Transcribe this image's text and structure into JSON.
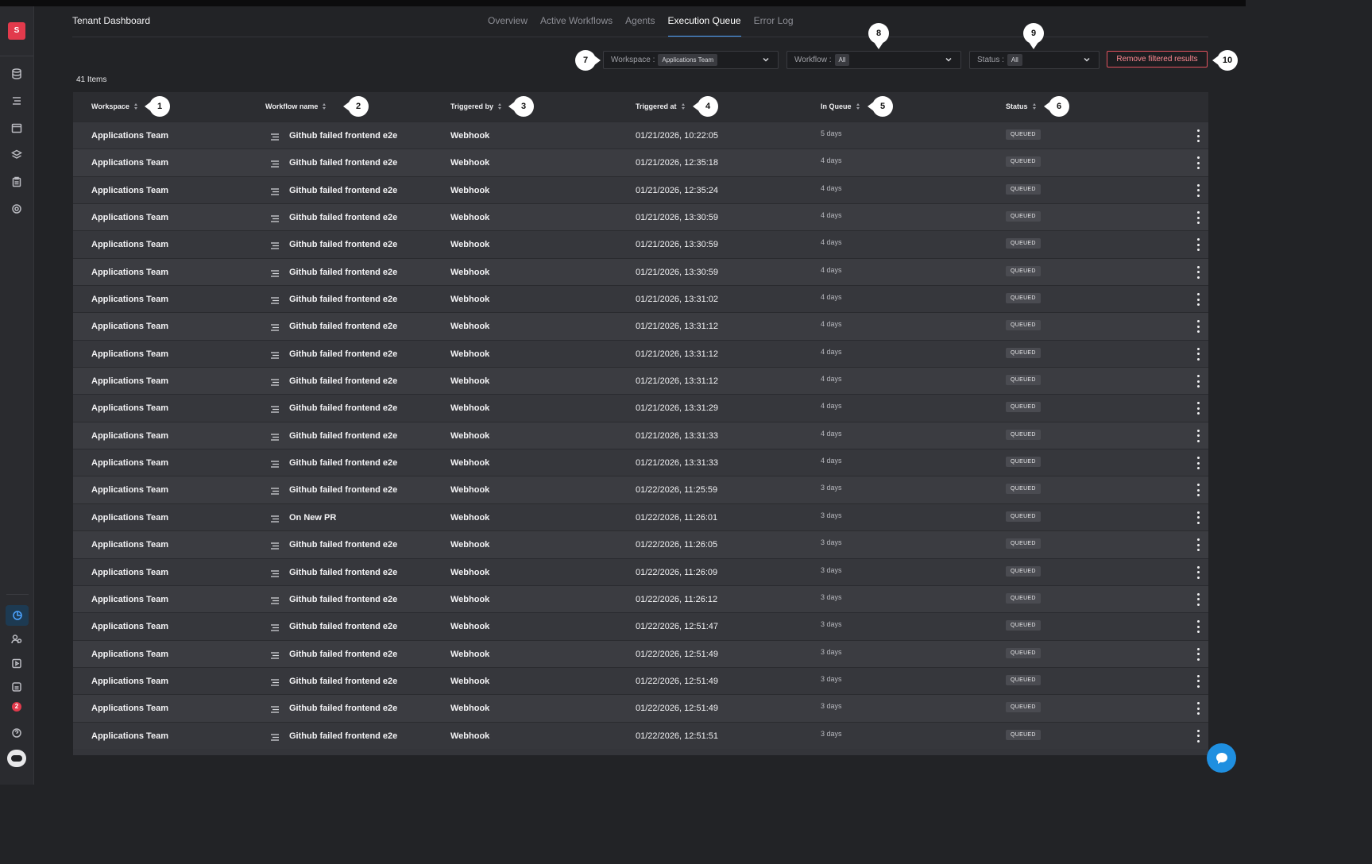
{
  "app": {
    "logo_letter": "S",
    "title": "Tenant Dashboard"
  },
  "tabs": [
    {
      "label": "Overview",
      "active": false
    },
    {
      "label": "Active Workflows",
      "active": false
    },
    {
      "label": "Agents",
      "active": false
    },
    {
      "label": "Execution Queue",
      "active": true
    },
    {
      "label": "Error Log",
      "active": false
    }
  ],
  "sidebar": {
    "top_icons": [
      "database-icon",
      "workflow-icon",
      "calendar-icon",
      "layers-icon",
      "clipboard-icon",
      "target-icon"
    ],
    "bottom_icons": [
      "dashboard-icon",
      "users-icon",
      "play-icon",
      "storage-icon",
      "bell-icon",
      "help-icon"
    ],
    "notification_count": "2"
  },
  "filters": {
    "workspace": {
      "label": "Workspace :",
      "value": "Applications Team"
    },
    "workflow": {
      "label": "Workflow :",
      "value": "All"
    },
    "status": {
      "label": "Status :",
      "value": "All"
    },
    "remove_label": "Remove filtered results"
  },
  "item_count": "41 Items",
  "table": {
    "columns": [
      "Workspace",
      "Workflow name",
      "Triggered by",
      "Triggered at",
      "In Queue",
      "Status"
    ],
    "rows": [
      [
        "Applications Team",
        "Github failed frontend e2e",
        "Webhook",
        "01/21/2026, 10:22:05",
        "5 days",
        "QUEUED"
      ],
      [
        "Applications Team",
        "Github failed frontend e2e",
        "Webhook",
        "01/21/2026, 12:35:18",
        "4 days",
        "QUEUED"
      ],
      [
        "Applications Team",
        "Github failed frontend e2e",
        "Webhook",
        "01/21/2026, 12:35:24",
        "4 days",
        "QUEUED"
      ],
      [
        "Applications Team",
        "Github failed frontend e2e",
        "Webhook",
        "01/21/2026, 13:30:59",
        "4 days",
        "QUEUED"
      ],
      [
        "Applications Team",
        "Github failed frontend e2e",
        "Webhook",
        "01/21/2026, 13:30:59",
        "4 days",
        "QUEUED"
      ],
      [
        "Applications Team",
        "Github failed frontend e2e",
        "Webhook",
        "01/21/2026, 13:30:59",
        "4 days",
        "QUEUED"
      ],
      [
        "Applications Team",
        "Github failed frontend e2e",
        "Webhook",
        "01/21/2026, 13:31:02",
        "4 days",
        "QUEUED"
      ],
      [
        "Applications Team",
        "Github failed frontend e2e",
        "Webhook",
        "01/21/2026, 13:31:12",
        "4 days",
        "QUEUED"
      ],
      [
        "Applications Team",
        "Github failed frontend e2e",
        "Webhook",
        "01/21/2026, 13:31:12",
        "4 days",
        "QUEUED"
      ],
      [
        "Applications Team",
        "Github failed frontend e2e",
        "Webhook",
        "01/21/2026, 13:31:12",
        "4 days",
        "QUEUED"
      ],
      [
        "Applications Team",
        "Github failed frontend e2e",
        "Webhook",
        "01/21/2026, 13:31:29",
        "4 days",
        "QUEUED"
      ],
      [
        "Applications Team",
        "Github failed frontend e2e",
        "Webhook",
        "01/21/2026, 13:31:33",
        "4 days",
        "QUEUED"
      ],
      [
        "Applications Team",
        "Github failed frontend e2e",
        "Webhook",
        "01/21/2026, 13:31:33",
        "4 days",
        "QUEUED"
      ],
      [
        "Applications Team",
        "Github failed frontend e2e",
        "Webhook",
        "01/22/2026, 11:25:59",
        "3 days",
        "QUEUED"
      ],
      [
        "Applications Team",
        "On New PR",
        "Webhook",
        "01/22/2026, 11:26:01",
        "3 days",
        "QUEUED"
      ],
      [
        "Applications Team",
        "Github failed frontend e2e",
        "Webhook",
        "01/22/2026, 11:26:05",
        "3 days",
        "QUEUED"
      ],
      [
        "Applications Team",
        "Github failed frontend e2e",
        "Webhook",
        "01/22/2026, 11:26:09",
        "3 days",
        "QUEUED"
      ],
      [
        "Applications Team",
        "Github failed frontend e2e",
        "Webhook",
        "01/22/2026, 11:26:12",
        "3 days",
        "QUEUED"
      ],
      [
        "Applications Team",
        "Github failed frontend e2e",
        "Webhook",
        "01/22/2026, 12:51:47",
        "3 days",
        "QUEUED"
      ],
      [
        "Applications Team",
        "Github failed frontend e2e",
        "Webhook",
        "01/22/2026, 12:51:49",
        "3 days",
        "QUEUED"
      ],
      [
        "Applications Team",
        "Github failed frontend e2e",
        "Webhook",
        "01/22/2026, 12:51:49",
        "3 days",
        "QUEUED"
      ],
      [
        "Applications Team",
        "Github failed frontend e2e",
        "Webhook",
        "01/22/2026, 12:51:49",
        "3 days",
        "QUEUED"
      ],
      [
        "Applications Team",
        "Github failed frontend e2e",
        "Webhook",
        "01/22/2026, 12:51:51",
        "3 days",
        "QUEUED"
      ]
    ]
  },
  "callouts": [
    "1",
    "2",
    "3",
    "4",
    "5",
    "6",
    "7",
    "8",
    "9",
    "10"
  ],
  "colors": {
    "accent": "#4da3ff",
    "danger": "#e2535f",
    "brand": "#e23a4c",
    "chat": "#1f8fe0"
  }
}
